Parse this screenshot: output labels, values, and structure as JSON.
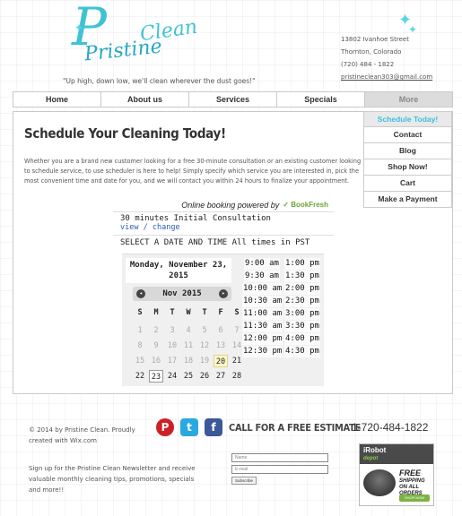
{
  "logo": {
    "letter": "P",
    "word1": "Pristine",
    "word2": "Clean"
  },
  "tagline": "\"Up high, down low, we'll clean wherever the dust goes!\"",
  "contact": {
    "street": "13802 Ivanhoe Street",
    "city": "Thornton, Colorado",
    "phone": "(720) 484 - 1822",
    "email": "pristineclean303@gmail.com"
  },
  "nav": [
    "Home",
    "About us",
    "Services",
    "Specials",
    "More"
  ],
  "dropdown": [
    "Schedule Today!",
    "Contact",
    "Blog",
    "Shop Now!",
    "Cart",
    "Make a Payment"
  ],
  "page": {
    "heading": "Schedule Your Cleaning Today!",
    "intro": "Whether you are a brand new customer looking for a free 30-minute consultation or an existing customer looking to schedule service, to use scheduler is here to help! Simply specify which service you are interested in, pick the most convenient time and date for you, and we will contact you within 24 hours to finalize your appointment."
  },
  "booking": {
    "powered_by": "Online booking powered by",
    "brand": "BookFresh",
    "service": "30 minutes Initial Consultation",
    "view": "view",
    "separator": "/",
    "change": "change",
    "select_label": "SELECT A DATE AND TIME All times in PST",
    "selected_date_line1": "Monday, November 23,",
    "selected_date_line2": "2015",
    "month": "Nov 2015",
    "prev_icon": "◂",
    "next_icon": "▸",
    "weekdays": [
      "S",
      "M",
      "T",
      "W",
      "T",
      "F",
      "S"
    ],
    "weeks": [
      [
        "1",
        "2",
        "3",
        "4",
        "5",
        "6",
        "7"
      ],
      [
        "8",
        "9",
        "10",
        "11",
        "12",
        "13",
        "14"
      ],
      [
        "15",
        "16",
        "17",
        "18",
        "19",
        "20",
        "21"
      ],
      [
        "22",
        "23",
        "24",
        "25",
        "26",
        "27",
        "28"
      ]
    ],
    "times": [
      [
        "9:00 am",
        "1:00 pm"
      ],
      [
        "9:30 am",
        "1:30 pm"
      ],
      [
        "10:00 am",
        "2:00 pm"
      ],
      [
        "10:30 am",
        "2:30 pm"
      ],
      [
        "11:00 am",
        "3:00 pm"
      ],
      [
        "11:30 am",
        "3:30 pm"
      ],
      [
        "12:00 pm",
        "4:00 pm"
      ],
      [
        "12:30 pm",
        "4:30 pm"
      ]
    ]
  },
  "footer": {
    "copyright": "© 2014 by Pristine Clean. Proudly created with Wix.com",
    "newsletter": "Sign up for the Pristine Clean Newsletter and receive valuable monthly cleaning tips, promotions, specials and more!!",
    "cta": "CALL FOR A FREE ESTIMATE",
    "phone": "1-720-484-1822",
    "name_placeholder": "Name",
    "email_placeholder": "E-mail",
    "subscribe": "Subscribe",
    "social": {
      "pinterest": "P",
      "twitter": "t",
      "facebook": "f"
    }
  },
  "ad": {
    "brand": "iRobot",
    "sub": "depot",
    "free": "FREE",
    "shipping": "SHIPPING ON ALL ORDERS",
    "button": "SHOP NOW"
  },
  "colors": {
    "accent": "#3cc0de",
    "nav_active": "#dcdcdc",
    "pinterest": "#cc2127",
    "twitter": "#2aa9e0",
    "facebook": "#3b5998"
  }
}
